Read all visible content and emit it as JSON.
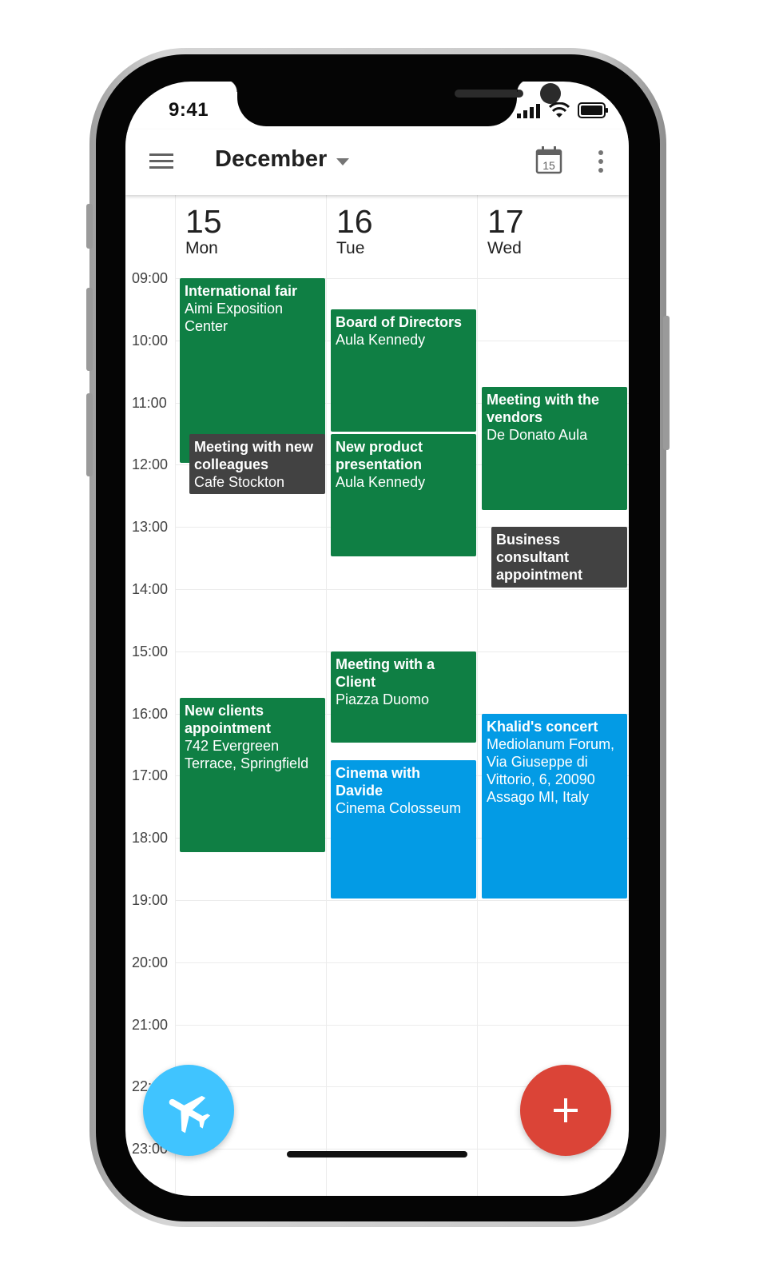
{
  "status_bar": {
    "time": "9:41"
  },
  "app_bar": {
    "month": "December",
    "today_date": "15"
  },
  "days": [
    {
      "num": "15",
      "name": "Mon"
    },
    {
      "num": "16",
      "name": "Tue"
    },
    {
      "num": "17",
      "name": "Wed"
    }
  ],
  "hours": [
    "09:00",
    "10:00",
    "11:00",
    "12:00",
    "13:00",
    "14:00",
    "15:00",
    "16:00",
    "17:00",
    "18:00",
    "19:00",
    "20:00",
    "21:00",
    "22:00",
    "23:00"
  ],
  "colors": {
    "green": "#0F7F44",
    "gray": "#424242",
    "blue": "#039BE5",
    "fab_travel": "#40C4FF",
    "fab_add": "#DB4437"
  },
  "events": [
    {
      "day": 0,
      "title": "International fair",
      "location": "Aimi Exposition Center",
      "start": "09:00",
      "end": "12:00",
      "color": "green"
    },
    {
      "day": 0,
      "title": "Meeting with new colleagues",
      "location": "Cafe Stockton",
      "start": "11:30",
      "end": "12:30",
      "color": "gray"
    },
    {
      "day": 0,
      "title": "New clients appointment",
      "location": "742 Evergreen Terrace, Springfield",
      "start": "15:45",
      "end": "18:15",
      "color": "green"
    },
    {
      "day": 1,
      "title": "Board of Directors",
      "location": "Aula Kennedy",
      "start": "09:30",
      "end": "11:30",
      "color": "green"
    },
    {
      "day": 1,
      "title": "New product presentation",
      "location": "Aula Kennedy",
      "start": "11:30",
      "end": "13:30",
      "color": "green"
    },
    {
      "day": 1,
      "title": "Meeting with a Client",
      "location": "Piazza Duomo",
      "start": "15:00",
      "end": "16:30",
      "color": "green"
    },
    {
      "day": 1,
      "title": "Cinema with Davide",
      "location": "Cinema Colosseum",
      "start": "16:45",
      "end": "19:00",
      "color": "blue"
    },
    {
      "day": 2,
      "title": "Meeting with the vendors",
      "location": "De Donato Aula",
      "start": "10:45",
      "end": "12:45",
      "color": "green"
    },
    {
      "day": 2,
      "title": "Business consultant appointment",
      "location": "",
      "start": "13:00",
      "end": "14:00",
      "color": "gray"
    },
    {
      "day": 2,
      "title": "Khalid's concert",
      "location": "Mediolanum Forum, Via Giuseppe di Vittorio, 6, 20090 Assago MI, Italy",
      "start": "16:00",
      "end": "19:00",
      "color": "blue"
    }
  ],
  "fabs": {
    "travel_icon": "airplane-icon",
    "add_icon": "plus-icon"
  }
}
